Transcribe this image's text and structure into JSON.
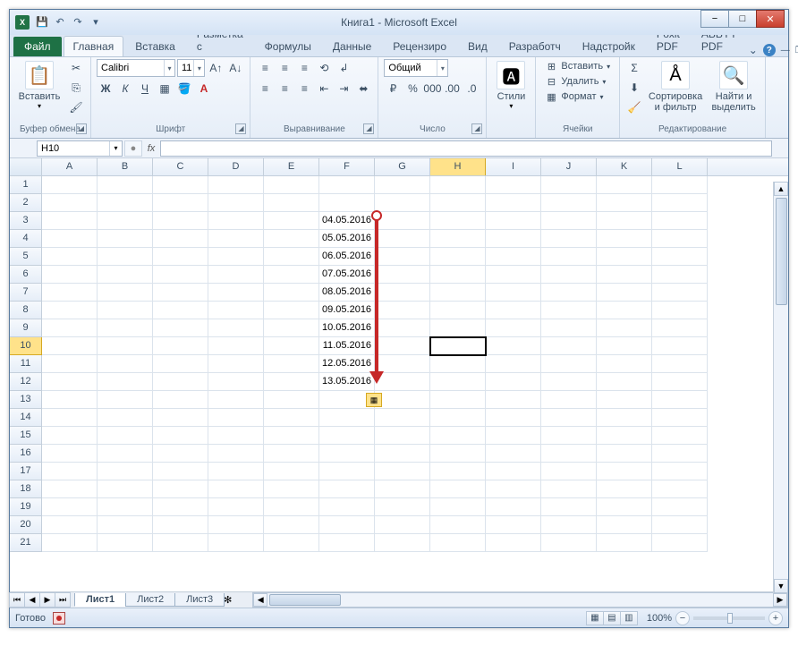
{
  "title": "Книга1  -  Microsoft Excel",
  "qat_icons": [
    "save-icon",
    "undo-icon",
    "redo-icon",
    "more-icon"
  ],
  "file_tab": "Файл",
  "tabs": [
    "Главная",
    "Вставка",
    "Разметка с",
    "Формулы",
    "Данные",
    "Рецензиро",
    "Вид",
    "Разработч",
    "Надстройк",
    "Foxit PDF",
    "ABBYY PDF"
  ],
  "active_tab": 0,
  "groups": {
    "clipboard": {
      "label": "Буфер обмена",
      "paste": "Вставить"
    },
    "font": {
      "label": "Шрифт",
      "name": "Calibri",
      "size": "11"
    },
    "align": {
      "label": "Выравнивание"
    },
    "number": {
      "label": "Число",
      "format": "Общий"
    },
    "styles": {
      "label": "",
      "btn": "Стили"
    },
    "cells": {
      "label": "Ячейки",
      "insert": "Вставить",
      "delete": "Удалить",
      "format": "Формат"
    },
    "editing": {
      "label": "Редактирование",
      "sort": "Сортировка\nи фильтр",
      "find": "Найти и\nвыделить"
    }
  },
  "name_box": "H10",
  "formula": "",
  "columns": [
    "A",
    "B",
    "C",
    "D",
    "E",
    "F",
    "G",
    "H",
    "I",
    "J",
    "K",
    "L"
  ],
  "sel_col": 7,
  "rows": 21,
  "sel_row": 10,
  "cell_data": {
    "F3": "04.05.2016",
    "F4": "05.05.2016",
    "F5": "06.05.2016",
    "F6": "07.05.2016",
    "F7": "08.05.2016",
    "F8": "09.05.2016",
    "F9": "10.05.2016",
    "F10": "11.05.2016",
    "F11": "12.05.2016",
    "F12": "13.05.2016"
  },
  "active_cell": {
    "col": 7,
    "row": 10
  },
  "sheets": [
    "Лист1",
    "Лист2",
    "Лист3"
  ],
  "active_sheet": 0,
  "status": "Готово",
  "zoom": "100%"
}
